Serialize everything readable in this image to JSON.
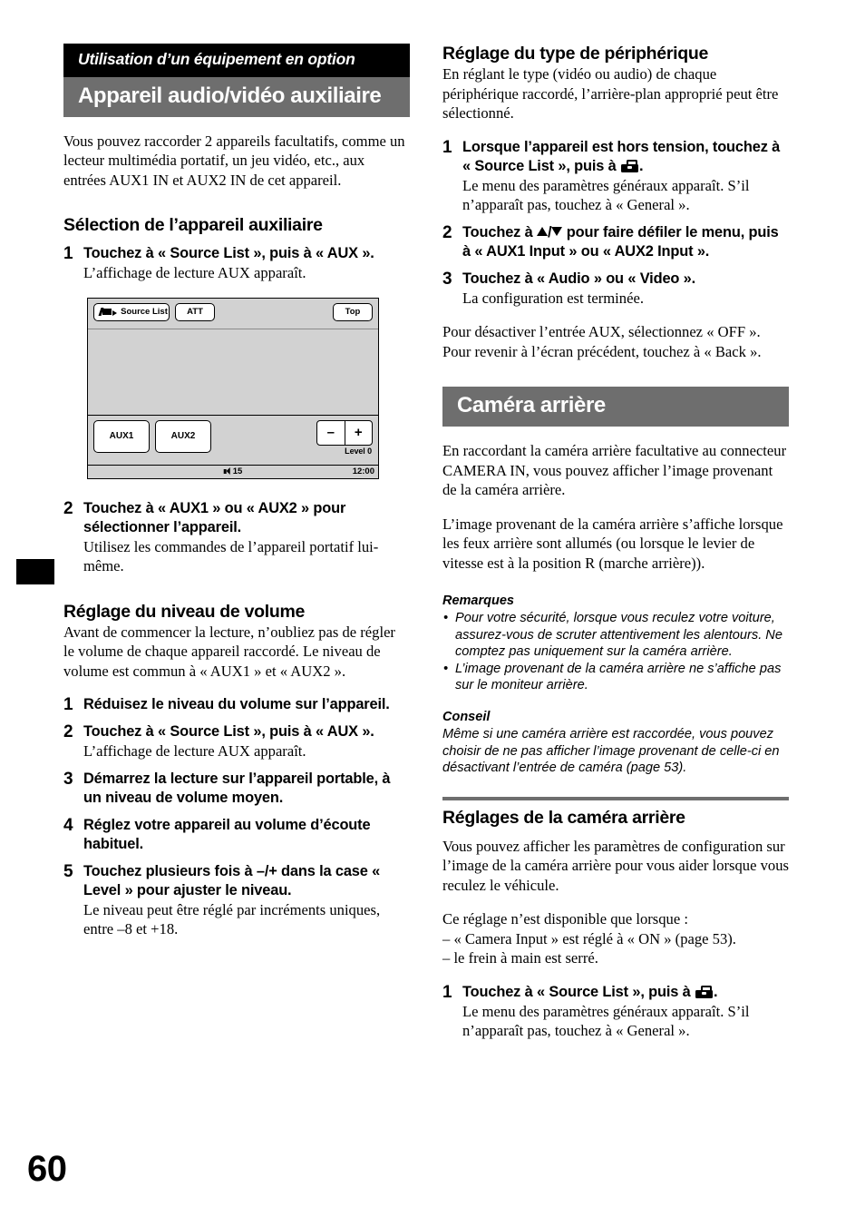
{
  "page": {
    "number": "60"
  },
  "left": {
    "banner_black": "Utilisation d’un équipement en option",
    "banner_gray": "Appareil audio/vidéo auxiliaire",
    "intro": "Vous pouvez raccorder 2 appareils facultatifs, comme un lecteur multimédia portatif, un jeu vidéo, etc., aux entrées AUX1 IN et AUX2 IN de cet appareil.",
    "section_selection": {
      "heading": "Sélection de l’appareil auxiliaire",
      "steps": [
        {
          "num": "1",
          "title": "Touchez à « Source List », puis à « AUX ».",
          "desc": "L’affichage de lecture AUX apparaît."
        },
        {
          "num": "2",
          "title": "Touchez à « AUX1 » ou « AUX2 » pour sélectionner l’appareil.",
          "desc": "Utilisez les commandes de l’appareil portatif lui-même."
        }
      ]
    },
    "device_screen": {
      "source_list_button": "Source List",
      "source_list_icon": "source-list-icon",
      "att_button": "ATT",
      "top_button": "Top",
      "aux1_button": "AUX1",
      "aux2_button": "AUX2",
      "minus_button": "–",
      "plus_button": "+",
      "level_label": "Level 0",
      "status_volume": "15",
      "status_volume_icon": "speaker-icon",
      "status_time": "12:00"
    },
    "section_volume": {
      "heading": "Réglage du niveau de volume",
      "intro": "Avant de commencer la lecture, n’oubliez pas de régler le volume de chaque appareil raccordé. Le niveau de volume est commun à « AUX1 » et « AUX2 ».",
      "steps": [
        {
          "num": "1",
          "title": "Réduisez le niveau du volume sur l’appareil.",
          "desc": ""
        },
        {
          "num": "2",
          "title": "Touchez à « Source List », puis à « AUX ».",
          "desc": "L’affichage de lecture AUX apparaît."
        },
        {
          "num": "3",
          "title": "Démarrez la lecture sur l’appareil portable, à un niveau de volume moyen.",
          "desc": ""
        },
        {
          "num": "4",
          "title": "Réglez votre appareil au volume d’écoute habituel.",
          "desc": ""
        },
        {
          "num": "5",
          "title": "Touchez plusieurs fois à –/+ dans la case « Level » pour ajuster le niveau.",
          "desc": "Le niveau peut être réglé par incréments uniques, entre –8 et +18."
        }
      ]
    }
  },
  "right": {
    "section_device_type": {
      "heading": "Réglage du type de périphérique",
      "intro": "En réglant le type (vidéo ou audio) de chaque périphérique raccordé, l’arrière-plan approprié peut être sélectionné.",
      "step1": {
        "num": "1",
        "title_before": "Lorsque l’appareil est hors tension, touchez à « Source List », puis à ",
        "title_icon": "toolbox-icon",
        "title_after": ".",
        "desc": "Le menu des paramètres généraux apparaît. S’il n’apparaît pas, touchez à « General »."
      },
      "step2": {
        "num": "2",
        "title_before": "Touchez à ",
        "icon_up": "triangle-up-icon",
        "title_mid": "/",
        "icon_down": "triangle-down-icon",
        "title_after": " pour faire défiler le menu, puis à « AUX1 Input » ou « AUX2 Input »."
      },
      "step3": {
        "num": "3",
        "title": "Touchez à « Audio » ou « Video ».",
        "desc": "La configuration est terminée."
      },
      "outro": "Pour désactiver l’entrée AUX, sélectionnez « OFF ».\nPour revenir à l’écran précédent, touchez à « Back »."
    },
    "banner_gray": "Caméra arrière",
    "camera_intro_1": "En raccordant la caméra arrière facultative au connecteur CAMERA IN, vous pouvez afficher l’image provenant de la caméra arrière.",
    "camera_intro_2": "L’image provenant de la caméra arrière s’affiche lorsque les feux arrière sont allumés (ou lorsque le levier de vitesse est à la position R (marche arrière)).",
    "notes": {
      "heading": "Remarques",
      "items": [
        "Pour votre sécurité, lorsque vous reculez votre voiture, assurez-vous de scruter attentivement les alentours. Ne comptez pas uniquement sur la caméra arrière.",
        "L’image provenant de la caméra arrière ne s’affiche pas sur le moniteur arrière."
      ]
    },
    "tip": {
      "heading": "Conseil",
      "text": "Même si une caméra arrière est raccordée, vous pouvez choisir de ne pas afficher l’image provenant de celle-ci en désactivant l’entrée de caméra (page 53)."
    },
    "section_camera_settings": {
      "heading": "Réglages de la caméra arrière",
      "intro_1": "Vous pouvez afficher les paramètres de configuration sur l’image de la caméra arrière pour vous aider lorsque vous reculez le véhicule.",
      "intro_2": "Ce réglage n’est disponible que lorsque :",
      "cond_1": "– « Camera Input » est réglé à « ON » (page 53).",
      "cond_2": "– le frein à main est serré.",
      "step1": {
        "num": "1",
        "title_before": "Touchez à « Source List », puis à ",
        "title_icon": "toolbox-icon",
        "title_after": ".",
        "desc": "Le menu des paramètres généraux apparaît. S’il n’apparaît pas, touchez à « General »."
      }
    }
  }
}
